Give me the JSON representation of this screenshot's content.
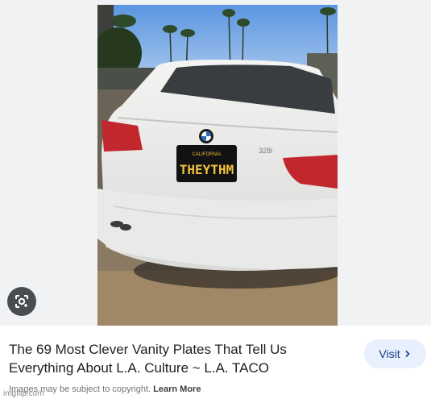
{
  "image_result": {
    "plate_text": "THEYTHM",
    "plate_state": "CALIFORNIA",
    "trunk_badge": "328i",
    "title": "The 69 Most Clever Vanity Plates That Tell Us Everything About L.A. Culture ~ L.A. TACO",
    "visit_label": "Visit",
    "copyright_text": "Images may be subject to copyright.",
    "learn_more_label": "Learn More"
  },
  "icons": {
    "lens": "google-lens-icon",
    "visit_chevron": "chevron-right-icon"
  },
  "watermark": "imgflip.com",
  "colors": {
    "visit_bg": "#e8f0fe",
    "visit_text": "#1a3d80",
    "preview_bg": "#f1f2f4"
  }
}
